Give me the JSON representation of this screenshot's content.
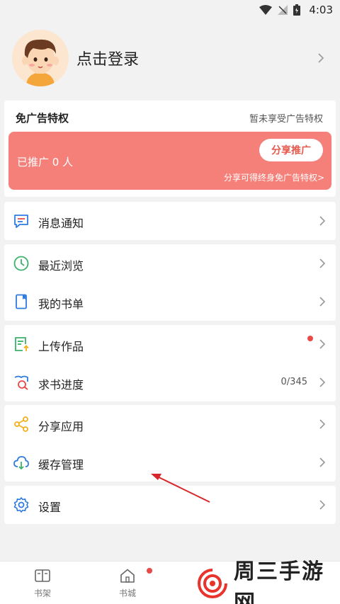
{
  "status_bar": {
    "time": "4:03"
  },
  "profile": {
    "login_label": "点击登录"
  },
  "ad_privilege": {
    "title": "免广告特权",
    "status": "暂未享受广告特权",
    "promoted_text": "已推广 0 人",
    "share_button": "分享推广",
    "hint": "分享可得终身免广告特权>"
  },
  "menu": {
    "messages": "消息通知",
    "recent": "最近浏览",
    "booklist": "我的书单",
    "upload": "上传作品",
    "request_progress": "求书进度",
    "request_count": "0/345",
    "share_app": "分享应用",
    "cache": "缓存管理",
    "settings": "设置"
  },
  "bottom_nav": {
    "shelf": "书架",
    "store": "书城"
  },
  "watermark": {
    "text": "周三手游网"
  },
  "colors": {
    "accent_red": "#f5807a",
    "badge_red": "#e84a4a",
    "icon_blue": "#2f7be0",
    "icon_green": "#3bb36a",
    "icon_yellow": "#f2b01e"
  }
}
